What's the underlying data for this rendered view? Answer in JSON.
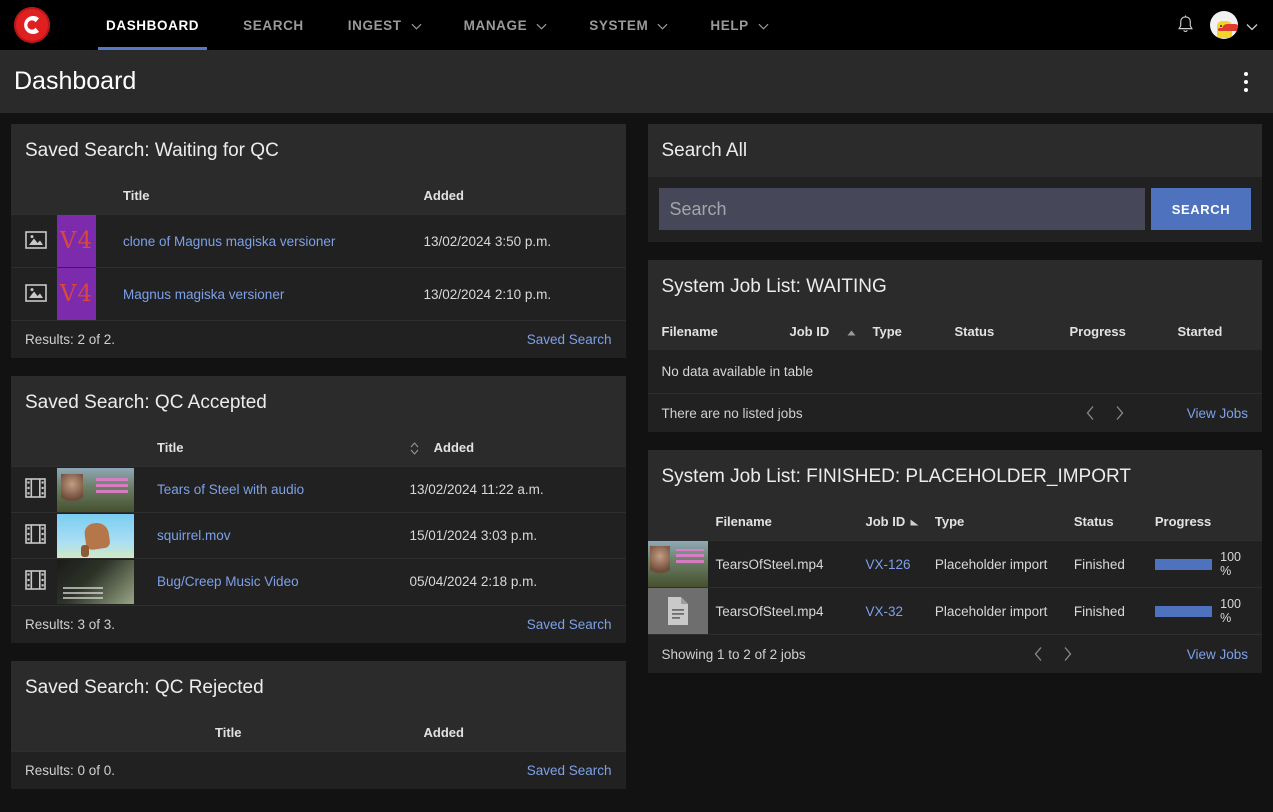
{
  "navbar": {
    "brand_icon": "vidispine-c-logo",
    "items": [
      {
        "label": "DASHBOARD",
        "has_caret": false,
        "active": true
      },
      {
        "label": "SEARCH",
        "has_caret": false,
        "active": false
      },
      {
        "label": "INGEST",
        "has_caret": true,
        "active": false
      },
      {
        "label": "MANAGE",
        "has_caret": true,
        "active": false
      },
      {
        "label": "SYSTEM",
        "has_caret": true,
        "active": false
      },
      {
        "label": "HELP",
        "has_caret": true,
        "active": false
      }
    ],
    "notifications_icon": "bell-icon",
    "avatar_icon": "user-avatar",
    "account_caret_icon": "chevron-down-icon",
    "accent_color": "#5579c6"
  },
  "titlebar": {
    "title": "Dashboard",
    "menu_icon": "kebab-menu-icon"
  },
  "waiting_for_qc": {
    "heading": "Saved Search: Waiting for QC",
    "columns": [
      "",
      "",
      "Title",
      "Added"
    ],
    "rows": [
      {
        "type_icon": "image-icon",
        "thumb": "V4",
        "title": "clone of Magnus magiska versioner",
        "added": "13/02/2024 3:50 p.m."
      },
      {
        "type_icon": "image-icon",
        "thumb": "V4",
        "title": "Magnus magiska versioner",
        "added": "13/02/2024 2:10 p.m."
      }
    ],
    "results": "Results: 2 of 2.",
    "link": "Saved Search"
  },
  "qc_accepted": {
    "heading": "Saved Search: QC Accepted",
    "columns": [
      "",
      "",
      "Title",
      "Added"
    ],
    "sort_icon": "sort-both-icon",
    "rows": [
      {
        "type_icon": "film-icon",
        "thumb": "tos",
        "title": "Tears of Steel with audio",
        "added": "13/02/2024 11:22 a.m."
      },
      {
        "type_icon": "film-icon",
        "thumb": "sq",
        "title": "squirrel.mov",
        "added": "15/01/2024 3:03 p.m."
      },
      {
        "type_icon": "film-icon",
        "thumb": "bug",
        "title": "Bug/Creep Music Video",
        "added": "05/04/2024 2:18 p.m."
      }
    ],
    "results": "Results: 3 of 3.",
    "link": "Saved Search"
  },
  "qc_rejected": {
    "heading": "Saved Search: QC Rejected",
    "columns": [
      "Title",
      "Added"
    ],
    "rows": [],
    "results": "Results: 0 of 0.",
    "link": "Saved Search"
  },
  "search_all": {
    "heading": "Search All",
    "placeholder": "Search",
    "value": "",
    "button_label": "SEARCH"
  },
  "job_list_waiting": {
    "heading": "System Job List: WAITING",
    "columns": [
      "Filename",
      "Job ID",
      "Type",
      "Status",
      "Progress",
      "Started"
    ],
    "sort_column": "Job ID",
    "sort_icon": "sort-asc-icon",
    "empty_text": "No data available in table",
    "footer_text": "There are no listed jobs",
    "prev_icon": "chevron-left-icon",
    "next_icon": "chevron-right-icon",
    "link": "View Jobs"
  },
  "job_list_finished": {
    "heading": "System Job List: FINISHED: PLACEHOLDER_IMPORT",
    "columns": [
      "",
      "Filename",
      "Job ID",
      "Type",
      "Status",
      "Progress"
    ],
    "sort_column": "Job ID",
    "sort_icon": "sort-asc-icon",
    "rows": [
      {
        "thumb": "photo",
        "filename": "TearsOfSteel.mp4",
        "job_id": "VX-126",
        "type": "Placeholder import",
        "status": "Finished",
        "progress": 100,
        "progress_label": "100 %"
      },
      {
        "thumb": "document-icon",
        "filename": "TearsOfSteel.mp4",
        "job_id": "VX-32",
        "type": "Placeholder import",
        "status": "Finished",
        "progress": 100,
        "progress_label": "100 %"
      }
    ],
    "footer_text": "Showing 1 to 2 of 2 jobs",
    "prev_icon": "chevron-left-icon",
    "next_icon": "chevron-right-icon",
    "link": "View Jobs"
  },
  "colors": {
    "accent_blue": "#4e72bd",
    "link_blue": "#7da0e8",
    "brand_red": "#e02020",
    "panel_bg": "#212121",
    "panel_head_bg": "#2b2b2b"
  }
}
